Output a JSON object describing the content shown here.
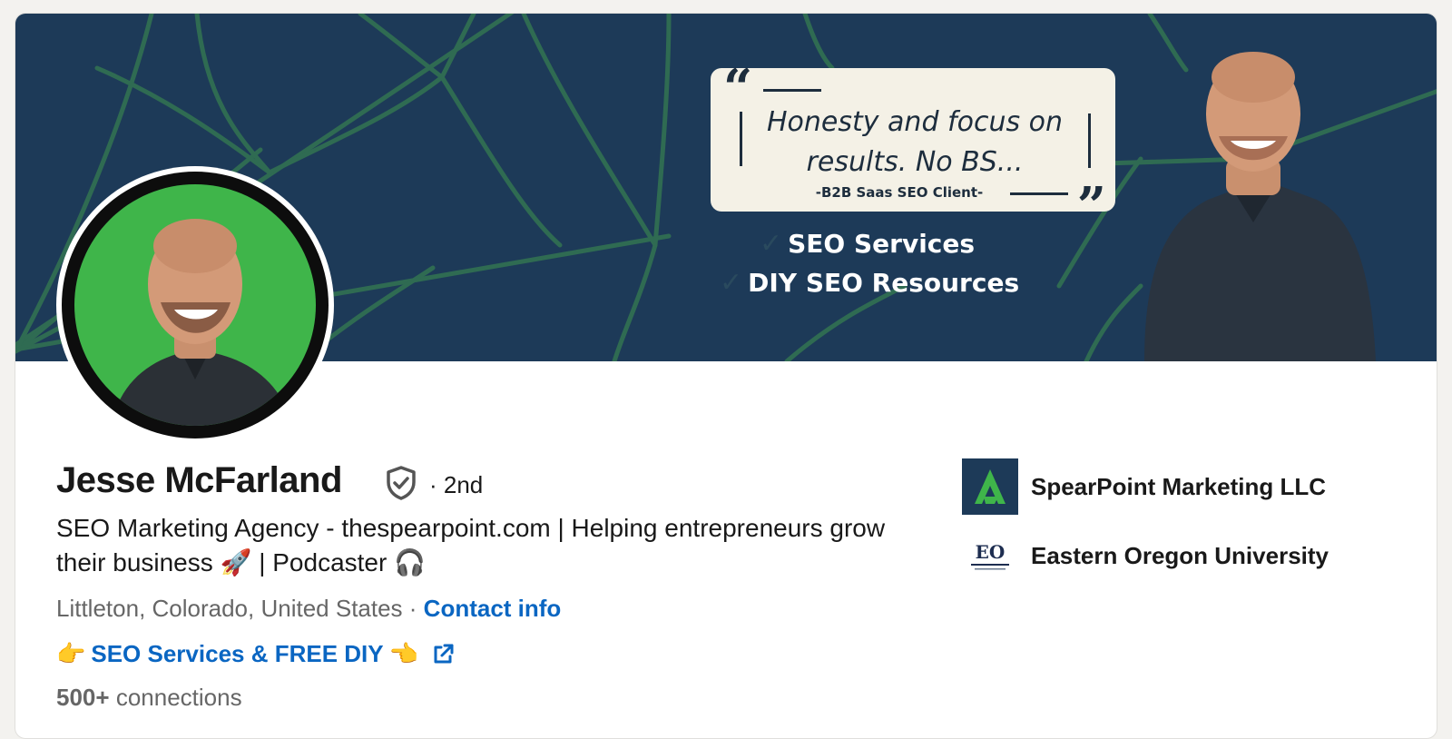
{
  "banner": {
    "quote": "Honesty and focus on results. No BS...",
    "quote_source": "-B2B Saas SEO Client-",
    "services": [
      "SEO Services",
      "DIY SEO Resources"
    ]
  },
  "profile": {
    "name": "Jesse McFarland",
    "degree": "· 2nd",
    "headline_part1": "SEO Marketing Agency - thespearpoint.com | Helping entrepreneurs grow their business ",
    "headline_emoji1": "🚀",
    "headline_part2": " | Podcaster ",
    "headline_emoji2": "🎧",
    "location": "Littleton, Colorado, United States",
    "separator": " · ",
    "contact_info": "Contact info",
    "website_prefix": "👉",
    "website_label": "SEO Services & FREE DIY",
    "website_suffix": "👈",
    "connections_count": "500+",
    "connections_label": "connections"
  },
  "organizations": [
    {
      "name": "SpearPoint Marketing LLC",
      "icon": "spearpoint-logo"
    },
    {
      "name": "Eastern Oregon University",
      "icon": "eou-logo",
      "logo_text": "EO"
    }
  ],
  "colors": {
    "banner_bg": "#1d3a58",
    "web_lines": "#2f6b52",
    "avatar_bg": "#3fb54a",
    "link": "#0a66c2",
    "text": "#191919",
    "muted": "#666666"
  }
}
